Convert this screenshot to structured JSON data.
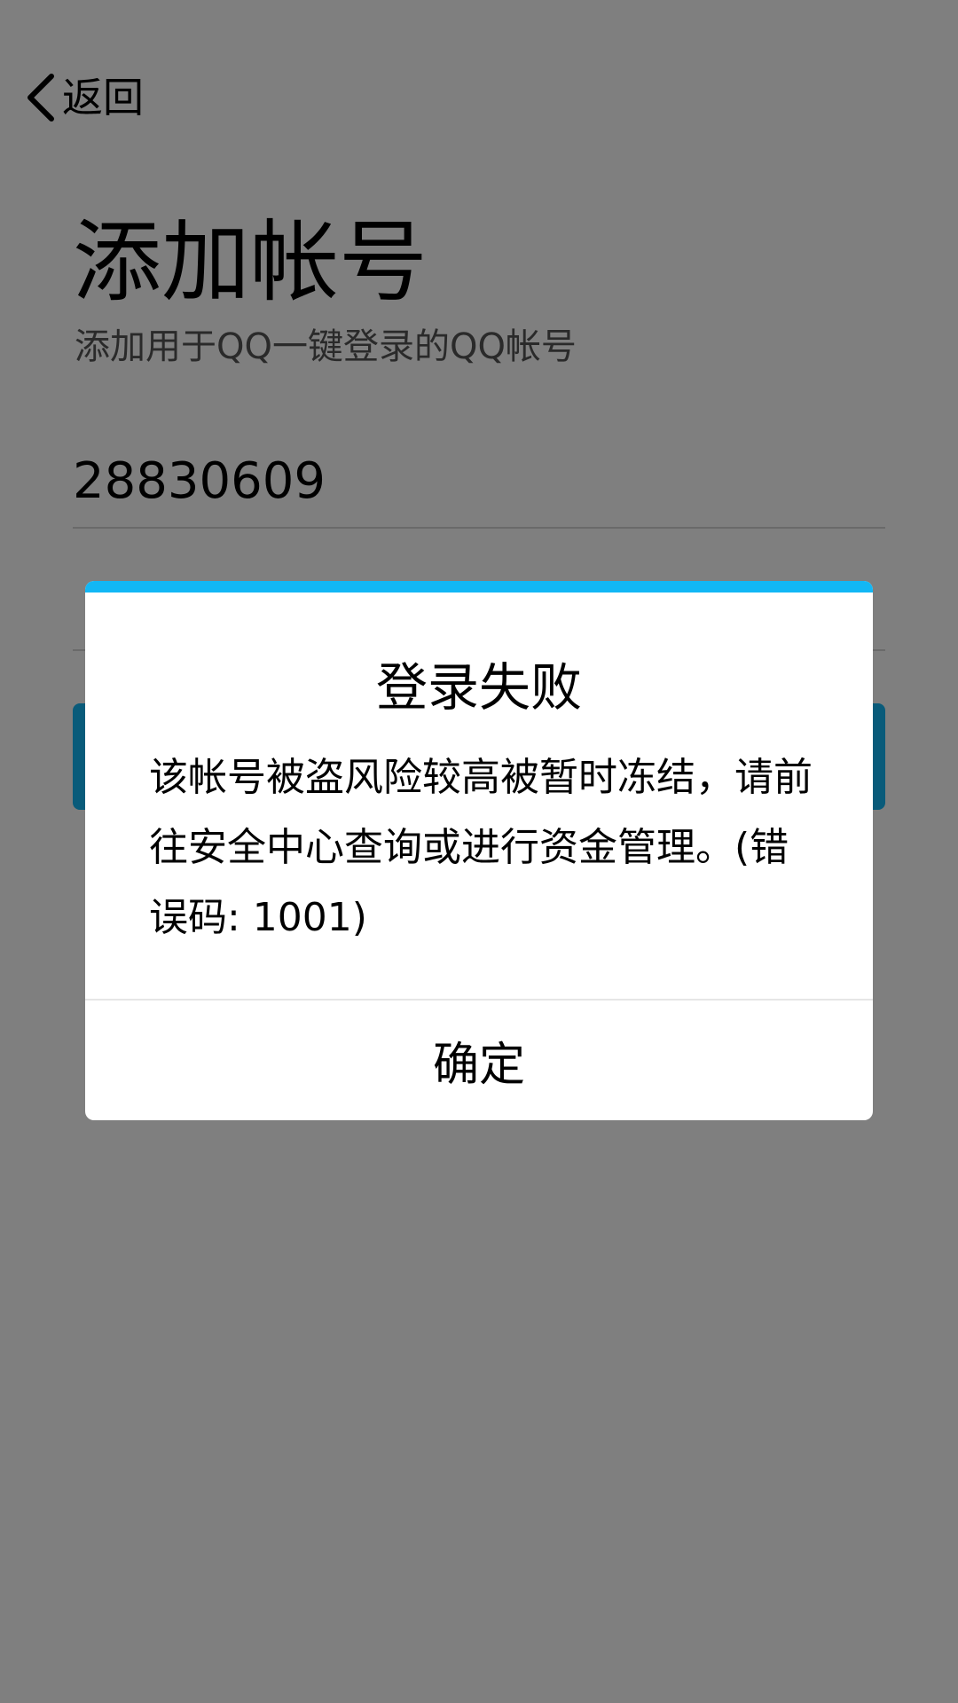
{
  "header": {
    "back_icon": "chevron-left-icon",
    "back_label": "返回"
  },
  "page": {
    "title": "添加帐号",
    "subtitle": "添加用于QQ一键登录的QQ帐号"
  },
  "form": {
    "account_value": "28830609",
    "password_value": ""
  },
  "dialog": {
    "title": "登录失败",
    "message": "该帐号被盗风险较高被暂时冻结，请前往安全中心查询或进行资金管理。(错误码: 1001)",
    "ok_label": "确定"
  },
  "colors": {
    "accent": "#12b7f5",
    "overlay": "rgba(0,0,0,0.5)",
    "subtitle_text": "#555555"
  }
}
